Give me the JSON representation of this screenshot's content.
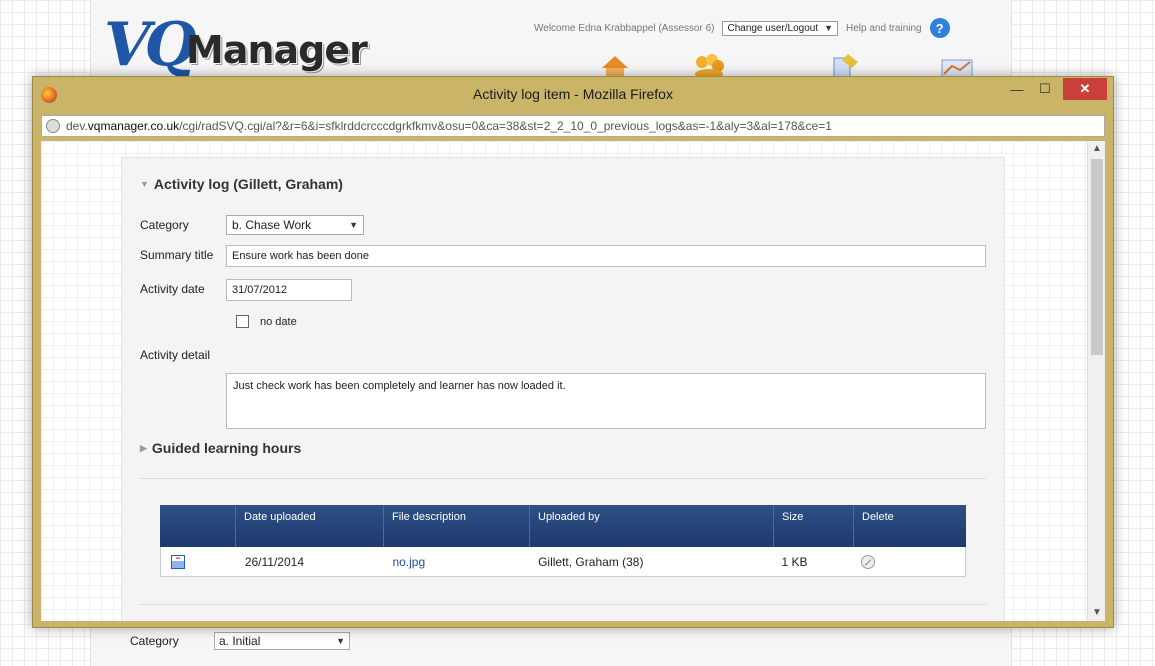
{
  "app": {
    "logo_text": "VQ Manager",
    "welcome": "Welcome Edna Krabbappel (Assessor 6)",
    "change_user": "Change user/Logout",
    "help": "Help and training"
  },
  "window": {
    "title": "Activity log item - Mozilla Firefox",
    "url_prefix": "dev.",
    "url_domain": "vqmanager.co.uk",
    "url_path": "/cgi/radSVQ.cgi/al?&r=6&i=sfklrddcrcccdgrkfkmv&osu=0&ca=38&st=2_2_10_0_previous_logs&as=-1&aly=3&al=178&ce=1"
  },
  "form": {
    "heading": "Activity log (Gillett, Graham)",
    "category_label": "Category",
    "category_value": "b. Chase Work",
    "summary_label": "Summary title",
    "summary_value": "Ensure work has been done",
    "date_label": "Activity date",
    "date_value": "31/07/2012",
    "no_date_label": "no date",
    "detail_label": "Activity detail",
    "detail_value": "Just check work has been completely and learner has now loaded it.",
    "glh_heading": "Guided learning hours"
  },
  "files": {
    "headers": [
      "",
      "Date uploaded",
      "File description",
      "Uploaded by",
      "Size",
      "Delete"
    ],
    "rows": [
      {
        "date": "26/11/2014",
        "description": "no.jpg",
        "uploaded_by": "Gillett, Graham (38)",
        "size": "1 KB"
      }
    ]
  },
  "background_form": {
    "category_label": "Category",
    "category_value": "a. Initial"
  },
  "colors": {
    "window_frame": "#c9b468",
    "table_header": "#1d3a6c",
    "close_button": "#c9403a",
    "link": "#214f9e"
  }
}
